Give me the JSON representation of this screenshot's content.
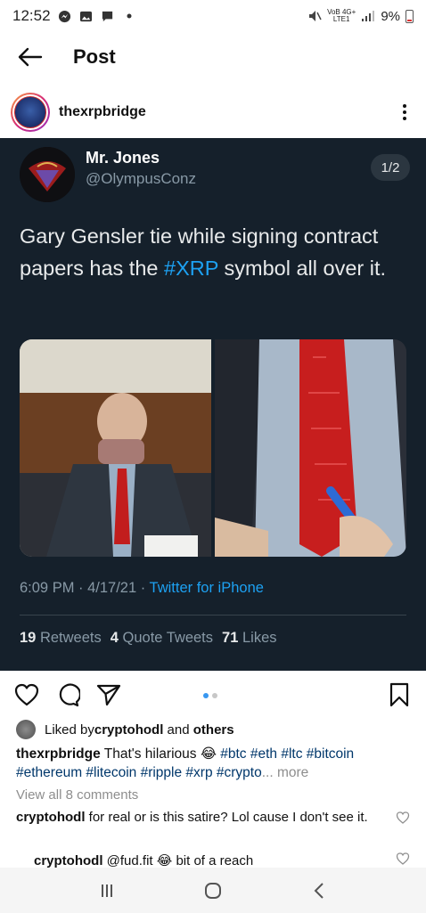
{
  "status_bar": {
    "time": "12:52",
    "network_label_top": "VoB 4G+",
    "network_label_bottom": "LTE1",
    "battery": "9%",
    "icons": [
      "messenger-icon",
      "gallery-icon",
      "chat-icon",
      "dot-icon",
      "mute-icon",
      "signal-icon",
      "battery-icon"
    ]
  },
  "header": {
    "title": "Post",
    "back_icon": "arrow-left-icon"
  },
  "post": {
    "username": "thexrpbridge",
    "menu_icon": "more-vertical-icon"
  },
  "tweet": {
    "name": "Mr. Jones",
    "handle": "@OlympusConz",
    "counter": "1/2",
    "text_before": "Gary Gensler tie while signing contract papers has the ",
    "hashtag": "#XRP",
    "text_after": " symbol all over it.",
    "timestamp": "6:09 PM · 4/17/21 · ",
    "source": "Twitter for iPhone",
    "retweets_num": "19",
    "retweets_label": "Retweets",
    "quote_num": "4",
    "quote_label": "Quote Tweets",
    "likes_num": "71",
    "likes_label": "Likes"
  },
  "actions": {
    "icons": [
      "heart-icon",
      "comment-icon",
      "share-icon",
      "bookmark-icon"
    ],
    "carousel_index": 1,
    "carousel_total": 2
  },
  "likes": {
    "prefix": "Liked by ",
    "user": "cryptohodl",
    "suffix": " and ",
    "others": "others"
  },
  "caption": {
    "user": "thexrpbridge",
    "text": " That's hilarious 😂 ",
    "tags": "#btc #eth #ltc #bitcoin #ethereum #litecoin #ripple #xrp #crypto",
    "ellipsis": "... ",
    "more": "more"
  },
  "view_comments": "View all 8 comments",
  "comments": [
    {
      "user": "cryptohodl",
      "text": " for real or is this satire? Lol cause I don't see it."
    },
    {
      "user": "cryptohodl",
      "text": " @fud.fit 😂 bit of a reach"
    }
  ],
  "colors": {
    "tweet_bg": "#15202b",
    "twitter_blue": "#1da1f2",
    "tag_blue": "#00376b",
    "muted": "#8e8e8e"
  }
}
